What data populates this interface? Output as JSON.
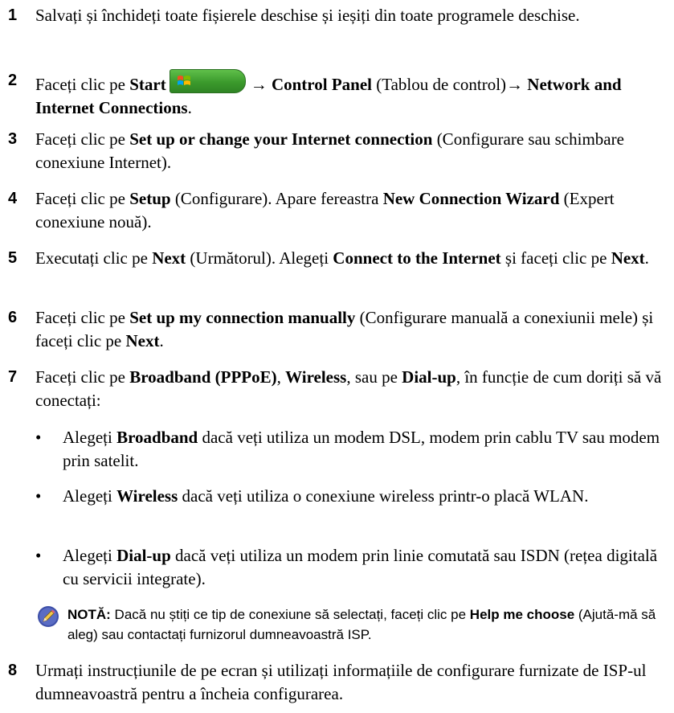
{
  "steps": [
    {
      "num": "1",
      "parts": [
        {
          "t": "Salvați și închideți toate fișierele deschise și ieșiți din toate programele deschise."
        }
      ]
    },
    {
      "num": "2",
      "parts": [
        {
          "t": "Faceți clic pe "
        },
        {
          "b": "Start"
        },
        {
          "start_btn": true
        },
        {
          "t": "→ "
        },
        {
          "b": "Control Panel"
        },
        {
          "t": " (Tablou de control)→ "
        },
        {
          "b": "Network and Internet Connections"
        },
        {
          "t": "."
        }
      ]
    },
    {
      "num": "3",
      "parts": [
        {
          "t": "Faceți clic pe "
        },
        {
          "b": "Set up or change your Internet connection"
        },
        {
          "t": " (Configurare sau schimbare conexiune Internet)."
        }
      ]
    },
    {
      "num": "4",
      "parts": [
        {
          "t": "Faceți clic pe "
        },
        {
          "b": "Setup"
        },
        {
          "t": " (Configurare). Apare fereastra "
        },
        {
          "b": "New Connection Wizard"
        },
        {
          "t": " (Expert conexiune nouă)."
        }
      ]
    },
    {
      "num": "5",
      "parts": [
        {
          "t": "Executați clic pe "
        },
        {
          "b": "Next"
        },
        {
          "t": " (Următorul). Alegeți "
        },
        {
          "b": "Connect to the Internet"
        },
        {
          "t": " și faceți clic pe "
        },
        {
          "b": "Next"
        },
        {
          "t": "."
        }
      ]
    },
    {
      "num": "6",
      "parts": [
        {
          "t": "Faceți clic pe "
        },
        {
          "b": "Set up my connection manually"
        },
        {
          "t": " (Configurare manuală a conexiunii mele) și faceți clic pe "
        },
        {
          "b": "Next"
        },
        {
          "t": "."
        }
      ]
    },
    {
      "num": "7",
      "parts": [
        {
          "t": "Faceți clic pe "
        },
        {
          "b": "Broadband (PPPoE)"
        },
        {
          "t": ", "
        },
        {
          "b": "Wireless"
        },
        {
          "t": ", sau pe "
        },
        {
          "b": "Dial-up"
        },
        {
          "t": ", în funcție de cum doriți să vă conectați:"
        }
      ]
    }
  ],
  "bullets": [
    {
      "parts": [
        {
          "t": "Alegeți "
        },
        {
          "b": "Broadband"
        },
        {
          "t": " dacă veți utiliza un modem DSL, modem prin cablu TV sau modem prin satelit."
        }
      ]
    },
    {
      "parts": [
        {
          "t": "Alegeți "
        },
        {
          "b": "Wireless"
        },
        {
          "t": " dacă veți utiliza o conexiune wireless printr-o placă WLAN."
        }
      ]
    },
    {
      "parts": [
        {
          "t": "Alegeți "
        },
        {
          "b": "Dial-up"
        },
        {
          "t": " dacă veți utiliza un modem prin linie comutată sau ISDN (rețea digitală cu servicii integrate)."
        }
      ]
    }
  ],
  "note": {
    "parts": [
      {
        "b": "NOTĂ:"
      },
      {
        "t": " Dacă nu știți ce tip de conexiune să selectați, faceți clic pe "
      },
      {
        "b": "Help me choose"
      },
      {
        "t": " (Ajută-mă să aleg) sau contactați furnizorul dumneavoastră ISP."
      }
    ]
  },
  "step8": {
    "num": "8",
    "parts": [
      {
        "t": "Urmați instrucțiunile de pe ecran și utilizați informațiile de configurare furnizate de ISP-ul dumneavoastră pentru a încheia configurarea."
      }
    ]
  }
}
